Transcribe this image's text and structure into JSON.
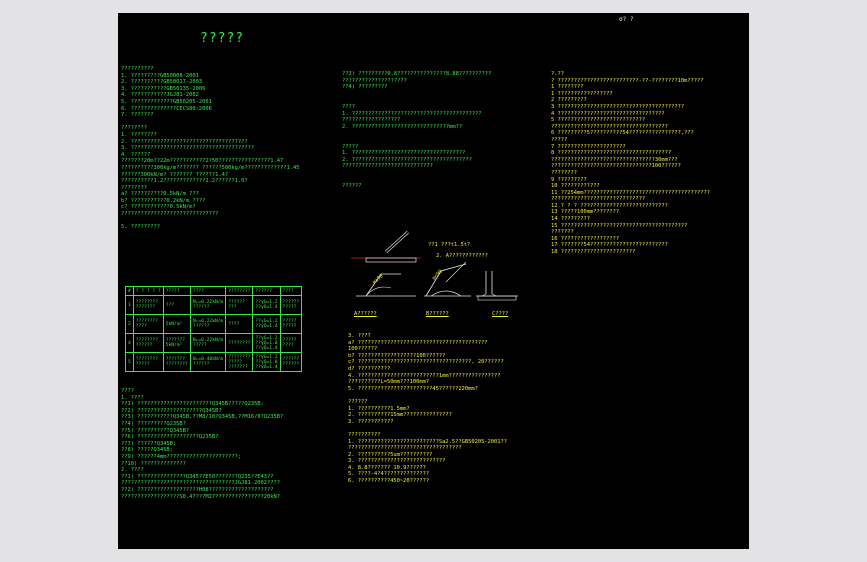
{
  "header": {
    "corner_label": "σ? ?"
  },
  "title": "?????",
  "col1": [
    {
      "text": "??????????",
      "c": "g"
    },
    {
      "text": " 1. ?????????GB50008-2001",
      "c": "g"
    },
    {
      "text": " 2. ??????????GB50017-2003",
      "c": "g"
    },
    {
      "text": " 3. ???????????GB50135-2006",
      "c": "g"
    },
    {
      "text": " 4. ???????????JGJ81-2002",
      "c": "g"
    },
    {
      "text": " 5. ?????????????GB50205-2001",
      "c": "g"
    },
    {
      "text": " 6. ??????????????CECS80:2006",
      "c": "g"
    },
    {
      "text": " 7. ???????",
      "c": "g"
    },
    {
      "text": "",
      "c": "g"
    },
    {
      "text": "????????",
      "c": "g"
    },
    {
      "text": " 1. ????????",
      "c": "g"
    },
    {
      "text": " 2. ????????????????????????????????????",
      "c": "g"
    },
    {
      "text": " 3. ??????????????????????????????????????",
      "c": "g"
    },
    {
      "text": " 4. ??????",
      "c": "g"
    },
    {
      "text": "  ???????20m??22m???????????2?50????????????????1.47",
      "c": "g"
    },
    {
      "text": "  ??????????300kg/m??????? ??????500kg/m?????????????1.45",
      "c": "g"
    },
    {
      "text": "     ??????300kN/m? ??????? ??????1.4?",
      "c": "g"
    },
    {
      "text": "  ??????????1.2?????????????1.2??????1.0?",
      "c": "g"
    },
    {
      "text": "  ????????",
      "c": "g"
    },
    {
      "text": "     a? ??????????0.5kN/m ???",
      "c": "g"
    },
    {
      "text": "     b? ???????????0.2kN/m ????",
      "c": "g"
    },
    {
      "text": "     c? ????????????0.5kN/m?",
      "c": "g"
    },
    {
      "text": "        ??????????????????????????????",
      "c": "g"
    },
    {
      "text": "",
      "c": "g"
    },
    {
      "text": " 5. ?????????",
      "c": "g"
    }
  ],
  "spec_table": {
    "headers": [
      "#",
      "? ? ? ? ?",
      "?????",
      "????",
      "????????",
      "??????",
      "????"
    ],
    "rows": [
      [
        "1",
        "????????\n???????",
        "???",
        "Nₖ=0.22kN/m\n??????",
        "??????\n???",
        "??γG=1.2\n??γQ=1.4",
        "??????\n?????"
      ],
      [
        "2",
        "????????\n????",
        "5kN/m²",
        "Nₖ=0.22kN/m\n??????",
        "????",
        "??γG=1.2\n??γQ=1.4",
        "?????\n?????"
      ],
      [
        "4",
        "????????\n??????",
        "???????\n5kN/m²",
        "Nₖ=0.22kN/m\n?????",
        "????????",
        "??γG=1.2\n??γQ=1.0\n??γQ=1.4",
        "?????\n????"
      ],
      [
        "5",
        "????????\n?????",
        "???????\n????????",
        "Nₖ=0.40kN/m\n??????",
        "????????\n?????\n???????",
        "??γG=1.2\n??γQ=1.0\n??γQ=1.4",
        "??????\n??????"
      ]
    ]
  },
  "col1b": [
    {
      "text": "????",
      "c": "g"
    },
    {
      "text": " 1. ????",
      "c": "g"
    },
    {
      "text": "  ??1) ???????????????????????Q345B?????Q235B;",
      "c": "g"
    },
    {
      "text": "  ??2) ????????????????????Q345B?",
      "c": "g"
    },
    {
      "text": "  ??3) ???????????Q345B,??M8/10?Q345B,??M16/8?Q235B?",
      "c": "g"
    },
    {
      "text": "  ??4) ?????????Q235B?",
      "c": "g"
    },
    {
      "text": "  ??5) ??????????Q345B?",
      "c": "g"
    },
    {
      "text": "  ??6) ???????????????????Q235B?",
      "c": "g"
    },
    {
      "text": "  ??7) ??????Q345B;",
      "c": "g"
    },
    {
      "text": "  ??8) ?????Q345B;",
      "c": "g"
    },
    {
      "text": "  ??9) ??????4mm??????????????????????;",
      "c": "g"
    },
    {
      "text": "  ??10) ??????????????",
      "c": "g"
    },
    {
      "text": " 2. ????",
      "c": "g"
    },
    {
      "text": "  ??1) ???????????????Q345??E50???????Q235??E43??",
      "c": "g"
    },
    {
      "text": "       ???????????????????????????????????JGJ81-2002????",
      "c": "g"
    },
    {
      "text": "  ??2) ???????????????????H08????????????????????",
      "c": "g"
    },
    {
      "text": "       ??????????????????S0.4????M27???????????????20kN?",
      "c": "g"
    }
  ],
  "col2": [
    {
      "text": "??3) ?????????0.8???????????????8.88??????????",
      "c": "g"
    },
    {
      "text": "      ????????????????????",
      "c": "g"
    },
    {
      "text": "??4) ?????????",
      "c": "g"
    },
    {
      "text": "",
      "c": "g"
    },
    {
      "text": "",
      "c": "g"
    },
    {
      "text": "????",
      "c": "g"
    },
    {
      "text": " 1. ????????????????????????????????????????",
      "c": "g"
    },
    {
      "text": "    ??????????????????",
      "c": "g"
    },
    {
      "text": "  2. ??????????????????????????????mm??",
      "c": "g"
    },
    {
      "text": "",
      "c": "g"
    },
    {
      "text": "",
      "c": "g"
    },
    {
      "text": "?????",
      "c": "g"
    },
    {
      "text": " 1. ???????????????????????????????????",
      "c": "g"
    },
    {
      "text": " 2. ?????????????????????????????????????",
      "c": "g"
    },
    {
      "text": "    ????????????????????????????",
      "c": "g"
    },
    {
      "text": "",
      "c": "g"
    },
    {
      "text": "",
      "c": "g"
    },
    {
      "text": " ??????",
      "c": "g"
    }
  ],
  "weld_notes": [
    {
      "text": "??1 ???t1.5t?",
      "c": "y"
    },
    {
      "text": "2. A????????????",
      "c": "y"
    }
  ],
  "weld_labels": [
    "A??????",
    "B??????",
    "C????"
  ],
  "col2b": [
    {
      "text": "3. ????",
      "c": "y"
    },
    {
      "text": "  a? ????????????????????????????????????????",
      "c": "y"
    },
    {
      "text": "     100??????",
      "c": "y"
    },
    {
      "text": "  b? ??????????????????100??????",
      "c": "y"
    },
    {
      "text": "  c? ???????????????????????????????????, 20??????",
      "c": "y"
    },
    {
      "text": "  d? ??????????",
      "c": "y"
    },
    {
      "text": "4. ?????????????????????????1mm????????????????",
      "c": "y"
    },
    {
      "text": "    ??????????L=50mm???100mm?",
      "c": "y"
    },
    {
      "text": "5. ???????????????????????45??????220mm?",
      "c": "y"
    },
    {
      "text": "",
      "c": "y"
    },
    {
      "text": "??????",
      "c": "y"
    },
    {
      "text": " 1. ??????????1.5mm?",
      "c": "y"
    },
    {
      "text": " 2. ??????????15mm???????????????",
      "c": "y"
    },
    {
      "text": " 3. ???????????",
      "c": "y"
    },
    {
      "text": "",
      "c": "y"
    },
    {
      "text": "??????????",
      "c": "y"
    },
    {
      "text": " 1. ?????????????????????????Sa2.5??GB50205-2001??",
      "c": "y"
    },
    {
      "text": "    ???????????????????????????????????",
      "c": "y"
    },
    {
      "text": " 2. ??????????5um??????????",
      "c": "y"
    },
    {
      "text": " 3. ???????????????????????????",
      "c": "y"
    },
    {
      "text": " 4. 8.8??????? 10.9??????",
      "c": "y"
    },
    {
      "text": " 5. ????-4?4??????????????",
      "c": "y"
    },
    {
      "text": " 6. ??????????450~20??????",
      "c": "y"
    }
  ],
  "col3": [
    {
      "text": "?.??",
      "c": "y"
    },
    {
      "text": "? ?????????????????????????-??-????????10m?????",
      "c": "y"
    },
    {
      "text": "1 ????????",
      "c": "y"
    },
    {
      "text": "1   ?????????????????",
      "c": "y"
    },
    {
      "text": "2   ?????????",
      "c": "y"
    },
    {
      "text": "3   ???????????????????????????????????????",
      "c": "y"
    },
    {
      "text": "4   ?????????????????????????????????",
      "c": "y"
    },
    {
      "text": "5   ???????????????????????????",
      "c": "y"
    },
    {
      "text": "      ????????????????????????????????????",
      "c": "y"
    },
    {
      "text": "6   ?????????5??????????54????????????????,???",
      "c": "y"
    },
    {
      "text": "      ?????",
      "c": "y"
    },
    {
      "text": "7   ?????????????????????",
      "c": "y"
    },
    {
      "text": "8   ???????????????????????????????????",
      "c": "y"
    },
    {
      "text": "      ????????????????????????????????30mm???",
      "c": "y"
    },
    {
      "text": "      ???????????????????????????????100??????",
      "c": "y"
    },
    {
      "text": "      ????????",
      "c": "y"
    },
    {
      "text": "9   ?????????",
      "c": "y"
    },
    {
      "text": "10  ????????????",
      "c": "y"
    },
    {
      "text": "11  ??254mm???????????????????????????????????????",
      "c": "y"
    },
    {
      "text": "      ?????????????????????????????",
      "c": "y"
    },
    {
      "text": "12  ? ? ? ???????????????????????????",
      "c": "y"
    },
    {
      "text": "13  ?????100mm????????",
      "c": "y"
    },
    {
      "text": "14  ?????????",
      "c": "y"
    },
    {
      "text": "15  ???????????????????????????????????????",
      "c": "y"
    },
    {
      "text": "      ???????",
      "c": "y"
    },
    {
      "text": "16  ??????????????????",
      "c": "y"
    },
    {
      "text": "17  ???????54????????????????????????",
      "c": "y"
    },
    {
      "text": "18  ???????????????????????",
      "c": "y"
    }
  ],
  "colors": {
    "green": "#37e84a",
    "yellow": "#f2ee2c",
    "white": "#e6e6e6",
    "red": "#e22020"
  }
}
